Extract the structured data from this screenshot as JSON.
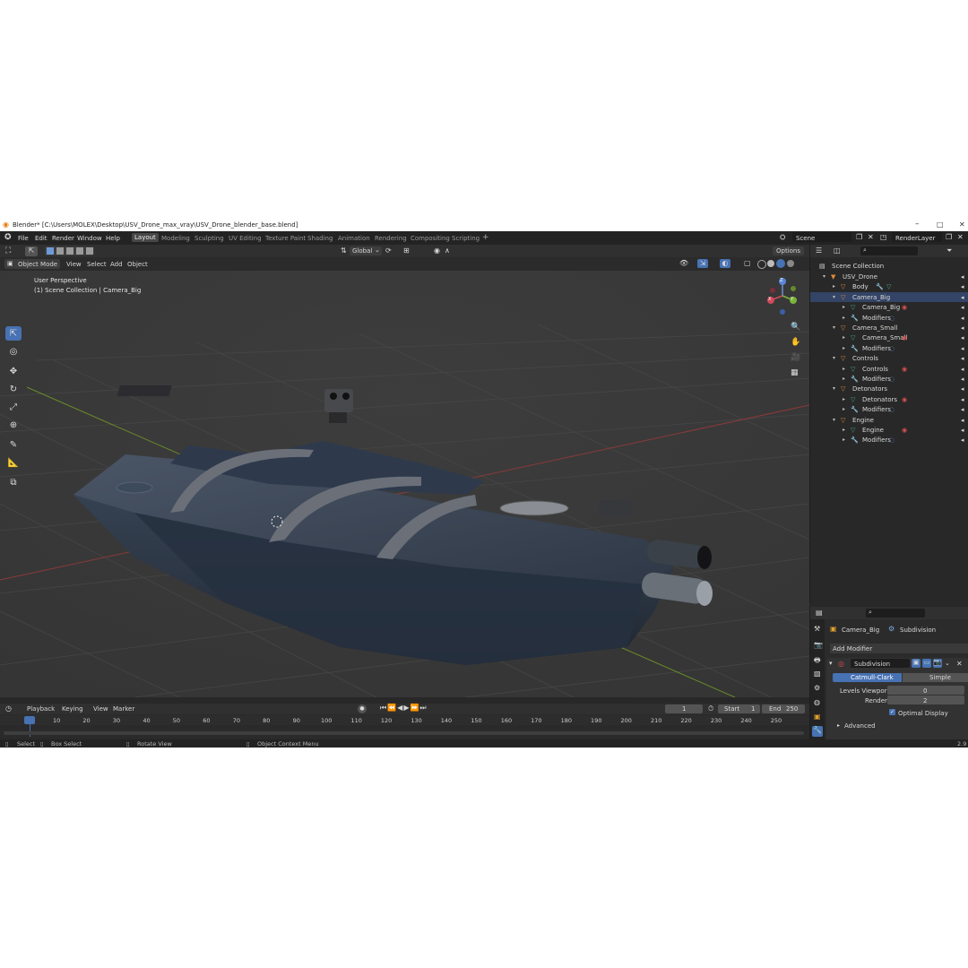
{
  "window": {
    "title": "Blender* [C:\\Users\\MOLEX\\Desktop\\USV_Drone_max_vray\\USV_Drone_blender_base.blend]",
    "controls": [
      "–",
      "□",
      "✕"
    ]
  },
  "menu": {
    "items": [
      "File",
      "Edit",
      "Render",
      "Window",
      "Help"
    ],
    "workspaces": [
      "Layout",
      "Modeling",
      "Sculpting",
      "UV Editing",
      "Texture Paint",
      "Shading",
      "Animation",
      "Rendering",
      "Compositing",
      "Scripting"
    ],
    "active_workspace": "Layout",
    "add_tab": "+",
    "scene_label": "Scene",
    "renderlayer_label": "RenderLayer"
  },
  "viewport_header": {
    "mode": "Object Mode",
    "menus": [
      "View",
      "Select",
      "Add",
      "Object"
    ],
    "orientation": "Global",
    "options": "Options"
  },
  "viewport": {
    "perspective": "User Perspective",
    "collection_info": "(1) Scene Collection | Camera_Big",
    "gizmo_axes": [
      "X",
      "Y",
      "Z"
    ]
  },
  "outliner": {
    "root": "Scene Collection",
    "rows": [
      {
        "label": "USV_Drone",
        "kind": "collection"
      },
      {
        "label": "Body",
        "kind": "object"
      },
      {
        "label": "Camera_Big",
        "kind": "object"
      },
      {
        "label": "Camera_Big",
        "kind": "mesh"
      },
      {
        "label": "Modifiers",
        "kind": "modifiers"
      },
      {
        "label": "Camera_Small",
        "kind": "object"
      },
      {
        "label": "Camera_Small",
        "kind": "mesh"
      },
      {
        "label": "Modifiers",
        "kind": "modifiers"
      },
      {
        "label": "Controls",
        "kind": "object"
      },
      {
        "label": "Controls",
        "kind": "mesh"
      },
      {
        "label": "Modifiers",
        "kind": "modifiers"
      },
      {
        "label": "Detonators",
        "kind": "object"
      },
      {
        "label": "Detonators",
        "kind": "mesh"
      },
      {
        "label": "Modifiers",
        "kind": "modifiers"
      },
      {
        "label": "Engine",
        "kind": "object"
      },
      {
        "label": "Engine",
        "kind": "mesh"
      },
      {
        "label": "Modifiers",
        "kind": "modifiers"
      }
    ]
  },
  "properties": {
    "object": "Camera_Big",
    "modifier_tab": "Subdivision",
    "add_modifier": "Add Modifier",
    "modifier_name": "Subdivision",
    "type_options": [
      "Catmull-Clark",
      "Simple"
    ],
    "active_type": "Catmull-Clark",
    "levels_viewport_label": "Levels Viewport",
    "levels_viewport_value": "0",
    "render_label": "Render",
    "render_value": "2",
    "optimal_display": "Optimal Display",
    "advanced": "Advanced"
  },
  "timeline": {
    "menus": [
      "Playback",
      "Keying",
      "View",
      "Marker"
    ],
    "current_frame": "1",
    "start_label": "Start",
    "start_value": "1",
    "end_label": "End",
    "end_value": "250",
    "ticks": [
      "1",
      "10",
      "20",
      "30",
      "40",
      "50",
      "60",
      "70",
      "80",
      "90",
      "100",
      "110",
      "120",
      "130",
      "140",
      "150",
      "160",
      "170",
      "180",
      "190",
      "200",
      "210",
      "220",
      "230",
      "240",
      "250"
    ]
  },
  "status": {
    "select": "Select",
    "box_select": "Box Select",
    "rotate_view": "Rotate View",
    "context_menu": "Object Context Menu",
    "version": "2.9"
  },
  "colors": {
    "accent": "#4772b3",
    "collection_orange": "#e08a3c",
    "mesh_green": "#41a985",
    "modifier_blue": "#5f8fd8",
    "material_red": "#d85050"
  }
}
